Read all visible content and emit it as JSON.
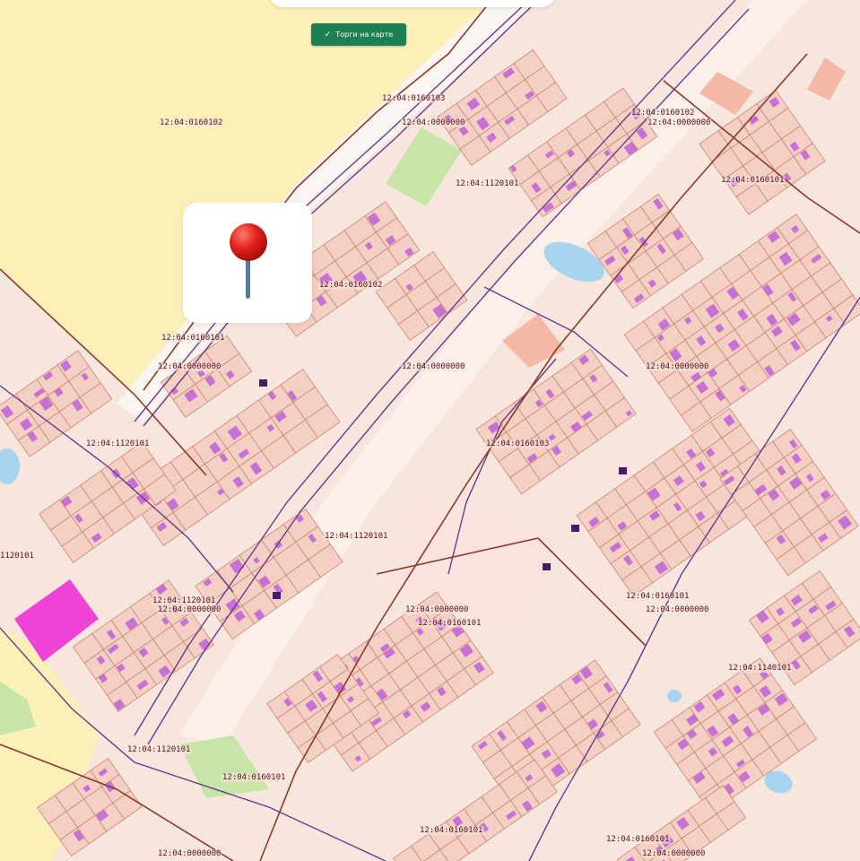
{
  "map": {
    "colors": {
      "background": "#f7e6dd",
      "land_yellow": "#fbf1b8",
      "parcel_fill": "#f4cfc3",
      "parcel_stroke": "#c98770",
      "building": "#c060d8",
      "road_purple": "#6a3a8a",
      "boundary_brown": "#8a3a2a",
      "water": "#a8d4ef",
      "park_green": "#c9e4a8",
      "magenta_block": "#ee44d6",
      "label_text": "#5a1020"
    },
    "cadastral_labels": [
      "12:04:0160102",
      "12:04:0160103",
      "12:04:0000000",
      "12:04:1120101",
      "12:04:0160102",
      "12:04:0160101",
      "12:04:0160102",
      "12:04:0000000",
      "12:04:0000000",
      "12:04:0000000",
      "12:04:1120101",
      "12:04:0160103",
      "12:04:0000000",
      "12:04:0160101",
      "12:04:1120101",
      "1120101",
      "12:04:1120101",
      "12:04:0000000",
      "12:04:0000000",
      "12:04:0160101",
      "12:04:0160101",
      "12:04:0000000",
      "12:04:1140101",
      "12:04:1120101",
      "12:04:0160101",
      "12:04:0160101",
      "12:04:0160101",
      "12:04:0000000",
      "12:04:0000000"
    ]
  },
  "toolbar": {
    "torgi_label": "Торги на карте",
    "check_icon": "check-icon"
  },
  "location_marker": {
    "icon": "pushpin-icon",
    "pin_color": "#e0201b",
    "needle_color": "#5b7a9a"
  }
}
